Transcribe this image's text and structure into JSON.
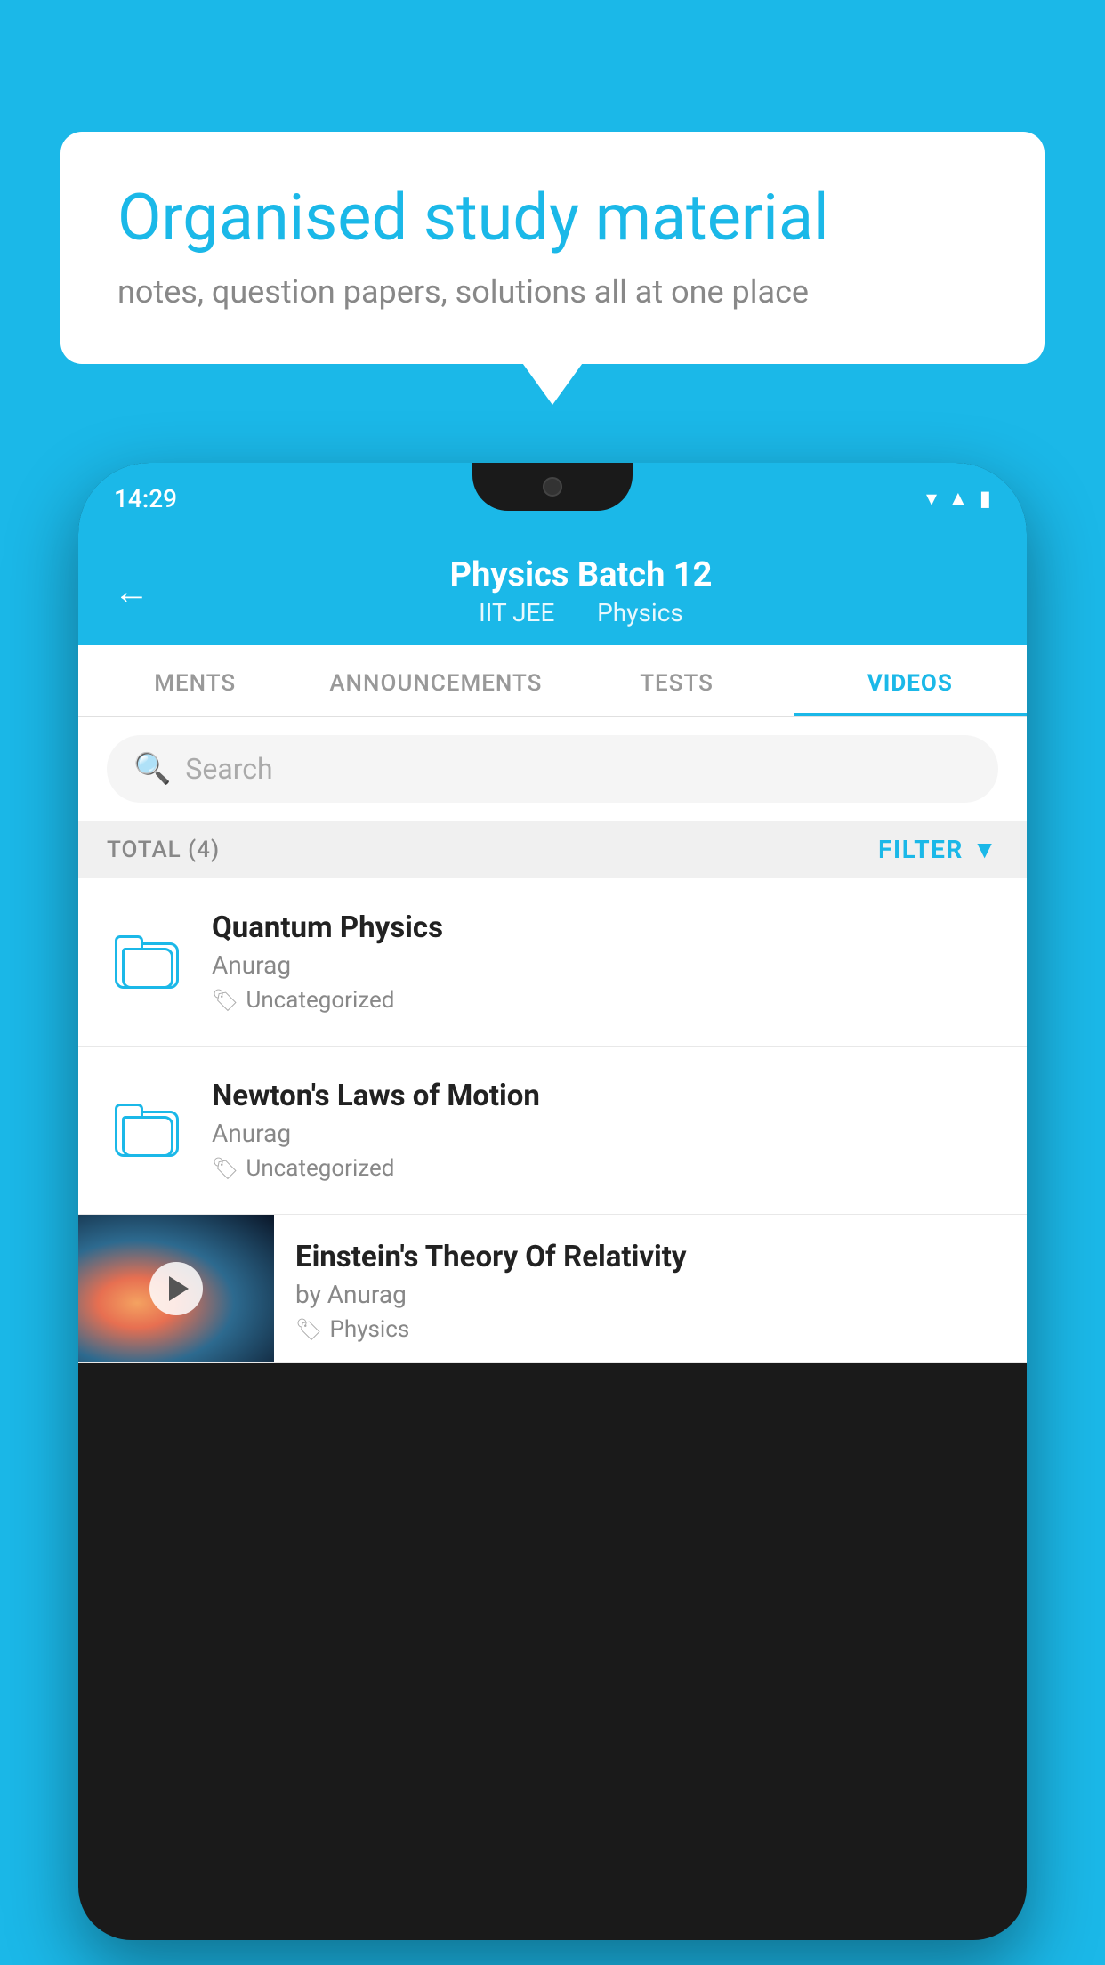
{
  "background": {
    "color": "#1BB8E8"
  },
  "speech_bubble": {
    "title": "Organised study material",
    "subtitle": "notes, question papers, solutions all at one place"
  },
  "phone": {
    "status_bar": {
      "time": "14:29",
      "icons": [
        "wifi",
        "signal",
        "battery"
      ]
    },
    "header": {
      "back_label": "←",
      "title": "Physics Batch 12",
      "subtitle_parts": [
        "IIT JEE",
        "Physics"
      ]
    },
    "tabs": [
      {
        "label": "MENTS",
        "active": false
      },
      {
        "label": "ANNOUNCEMENTS",
        "active": false
      },
      {
        "label": "TESTS",
        "active": false
      },
      {
        "label": "VIDEOS",
        "active": true
      }
    ],
    "search": {
      "placeholder": "Search"
    },
    "filter_bar": {
      "total_label": "TOTAL (4)",
      "filter_label": "FILTER"
    },
    "videos": [
      {
        "id": 1,
        "title": "Quantum Physics",
        "author": "Anurag",
        "tag": "Uncategorized",
        "type": "folder"
      },
      {
        "id": 2,
        "title": "Newton's Laws of Motion",
        "author": "Anurag",
        "tag": "Uncategorized",
        "type": "folder"
      },
      {
        "id": 3,
        "title": "Einstein's Theory Of Relativity",
        "author": "by Anurag",
        "tag": "Physics",
        "type": "video"
      }
    ]
  }
}
